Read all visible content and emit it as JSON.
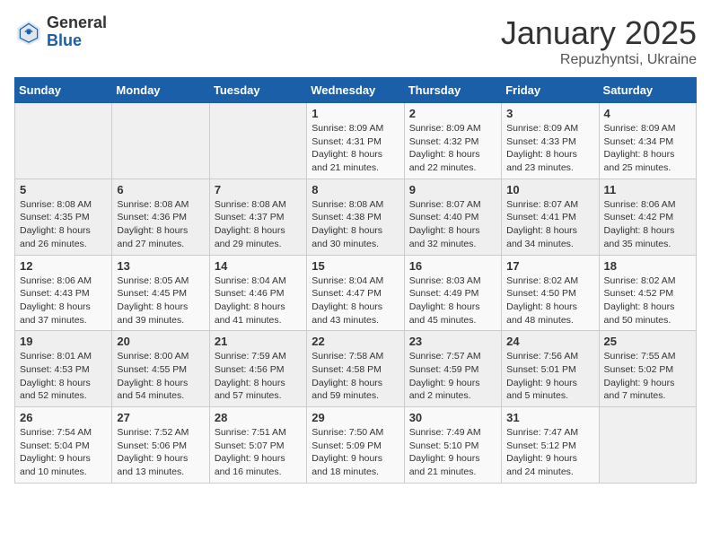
{
  "header": {
    "logo_general": "General",
    "logo_blue": "Blue",
    "month": "January 2025",
    "location": "Repuzhyntsi, Ukraine"
  },
  "days_of_week": [
    "Sunday",
    "Monday",
    "Tuesday",
    "Wednesday",
    "Thursday",
    "Friday",
    "Saturday"
  ],
  "weeks": [
    [
      {
        "day": "",
        "info": ""
      },
      {
        "day": "",
        "info": ""
      },
      {
        "day": "",
        "info": ""
      },
      {
        "day": "1",
        "info": "Sunrise: 8:09 AM\nSunset: 4:31 PM\nDaylight: 8 hours and 21 minutes."
      },
      {
        "day": "2",
        "info": "Sunrise: 8:09 AM\nSunset: 4:32 PM\nDaylight: 8 hours and 22 minutes."
      },
      {
        "day": "3",
        "info": "Sunrise: 8:09 AM\nSunset: 4:33 PM\nDaylight: 8 hours and 23 minutes."
      },
      {
        "day": "4",
        "info": "Sunrise: 8:09 AM\nSunset: 4:34 PM\nDaylight: 8 hours and 25 minutes."
      }
    ],
    [
      {
        "day": "5",
        "info": "Sunrise: 8:08 AM\nSunset: 4:35 PM\nDaylight: 8 hours and 26 minutes."
      },
      {
        "day": "6",
        "info": "Sunrise: 8:08 AM\nSunset: 4:36 PM\nDaylight: 8 hours and 27 minutes."
      },
      {
        "day": "7",
        "info": "Sunrise: 8:08 AM\nSunset: 4:37 PM\nDaylight: 8 hours and 29 minutes."
      },
      {
        "day": "8",
        "info": "Sunrise: 8:08 AM\nSunset: 4:38 PM\nDaylight: 8 hours and 30 minutes."
      },
      {
        "day": "9",
        "info": "Sunrise: 8:07 AM\nSunset: 4:40 PM\nDaylight: 8 hours and 32 minutes."
      },
      {
        "day": "10",
        "info": "Sunrise: 8:07 AM\nSunset: 4:41 PM\nDaylight: 8 hours and 34 minutes."
      },
      {
        "day": "11",
        "info": "Sunrise: 8:06 AM\nSunset: 4:42 PM\nDaylight: 8 hours and 35 minutes."
      }
    ],
    [
      {
        "day": "12",
        "info": "Sunrise: 8:06 AM\nSunset: 4:43 PM\nDaylight: 8 hours and 37 minutes."
      },
      {
        "day": "13",
        "info": "Sunrise: 8:05 AM\nSunset: 4:45 PM\nDaylight: 8 hours and 39 minutes."
      },
      {
        "day": "14",
        "info": "Sunrise: 8:04 AM\nSunset: 4:46 PM\nDaylight: 8 hours and 41 minutes."
      },
      {
        "day": "15",
        "info": "Sunrise: 8:04 AM\nSunset: 4:47 PM\nDaylight: 8 hours and 43 minutes."
      },
      {
        "day": "16",
        "info": "Sunrise: 8:03 AM\nSunset: 4:49 PM\nDaylight: 8 hours and 45 minutes."
      },
      {
        "day": "17",
        "info": "Sunrise: 8:02 AM\nSunset: 4:50 PM\nDaylight: 8 hours and 48 minutes."
      },
      {
        "day": "18",
        "info": "Sunrise: 8:02 AM\nSunset: 4:52 PM\nDaylight: 8 hours and 50 minutes."
      }
    ],
    [
      {
        "day": "19",
        "info": "Sunrise: 8:01 AM\nSunset: 4:53 PM\nDaylight: 8 hours and 52 minutes."
      },
      {
        "day": "20",
        "info": "Sunrise: 8:00 AM\nSunset: 4:55 PM\nDaylight: 8 hours and 54 minutes."
      },
      {
        "day": "21",
        "info": "Sunrise: 7:59 AM\nSunset: 4:56 PM\nDaylight: 8 hours and 57 minutes."
      },
      {
        "day": "22",
        "info": "Sunrise: 7:58 AM\nSunset: 4:58 PM\nDaylight: 8 hours and 59 minutes."
      },
      {
        "day": "23",
        "info": "Sunrise: 7:57 AM\nSunset: 4:59 PM\nDaylight: 9 hours and 2 minutes."
      },
      {
        "day": "24",
        "info": "Sunrise: 7:56 AM\nSunset: 5:01 PM\nDaylight: 9 hours and 5 minutes."
      },
      {
        "day": "25",
        "info": "Sunrise: 7:55 AM\nSunset: 5:02 PM\nDaylight: 9 hours and 7 minutes."
      }
    ],
    [
      {
        "day": "26",
        "info": "Sunrise: 7:54 AM\nSunset: 5:04 PM\nDaylight: 9 hours and 10 minutes."
      },
      {
        "day": "27",
        "info": "Sunrise: 7:52 AM\nSunset: 5:06 PM\nDaylight: 9 hours and 13 minutes."
      },
      {
        "day": "28",
        "info": "Sunrise: 7:51 AM\nSunset: 5:07 PM\nDaylight: 9 hours and 16 minutes."
      },
      {
        "day": "29",
        "info": "Sunrise: 7:50 AM\nSunset: 5:09 PM\nDaylight: 9 hours and 18 minutes."
      },
      {
        "day": "30",
        "info": "Sunrise: 7:49 AM\nSunset: 5:10 PM\nDaylight: 9 hours and 21 minutes."
      },
      {
        "day": "31",
        "info": "Sunrise: 7:47 AM\nSunset: 5:12 PM\nDaylight: 9 hours and 24 minutes."
      },
      {
        "day": "",
        "info": ""
      }
    ]
  ]
}
